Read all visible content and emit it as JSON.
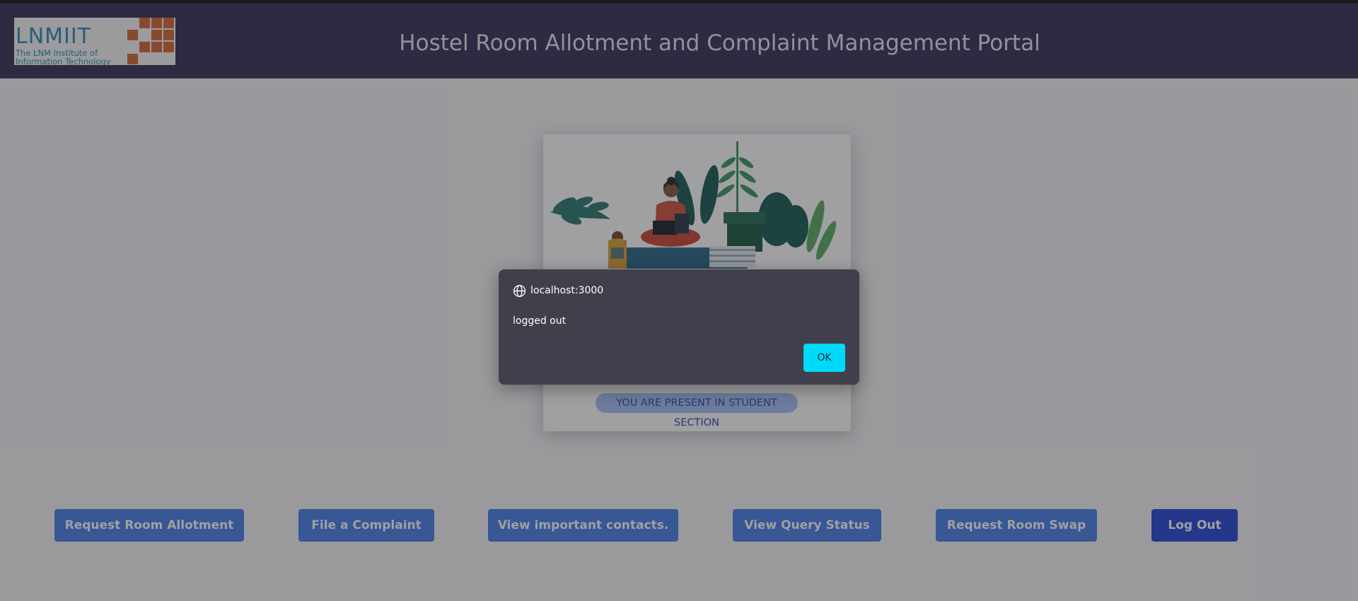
{
  "header": {
    "logo": {
      "name": "LNMIIT",
      "subtitle_line1": "The LNM Institute of",
      "subtitle_line2": "Information Technology"
    },
    "title": "Hostel Room Allotment and Complaint Management Portal"
  },
  "main": {
    "section_badge": "YOU ARE PRESENT IN STUDENT SECTION"
  },
  "nav": {
    "buttons": [
      "Request Room Allotment",
      "File a Complaint",
      "View important contacts.",
      "View Query Status",
      "Request Room Swap",
      "Log Out"
    ]
  },
  "dialog": {
    "icon": "globe-icon",
    "origin": "localhost:3000",
    "message": "logged out",
    "ok_label": "OK",
    "ok_color": "#00d9f8"
  }
}
